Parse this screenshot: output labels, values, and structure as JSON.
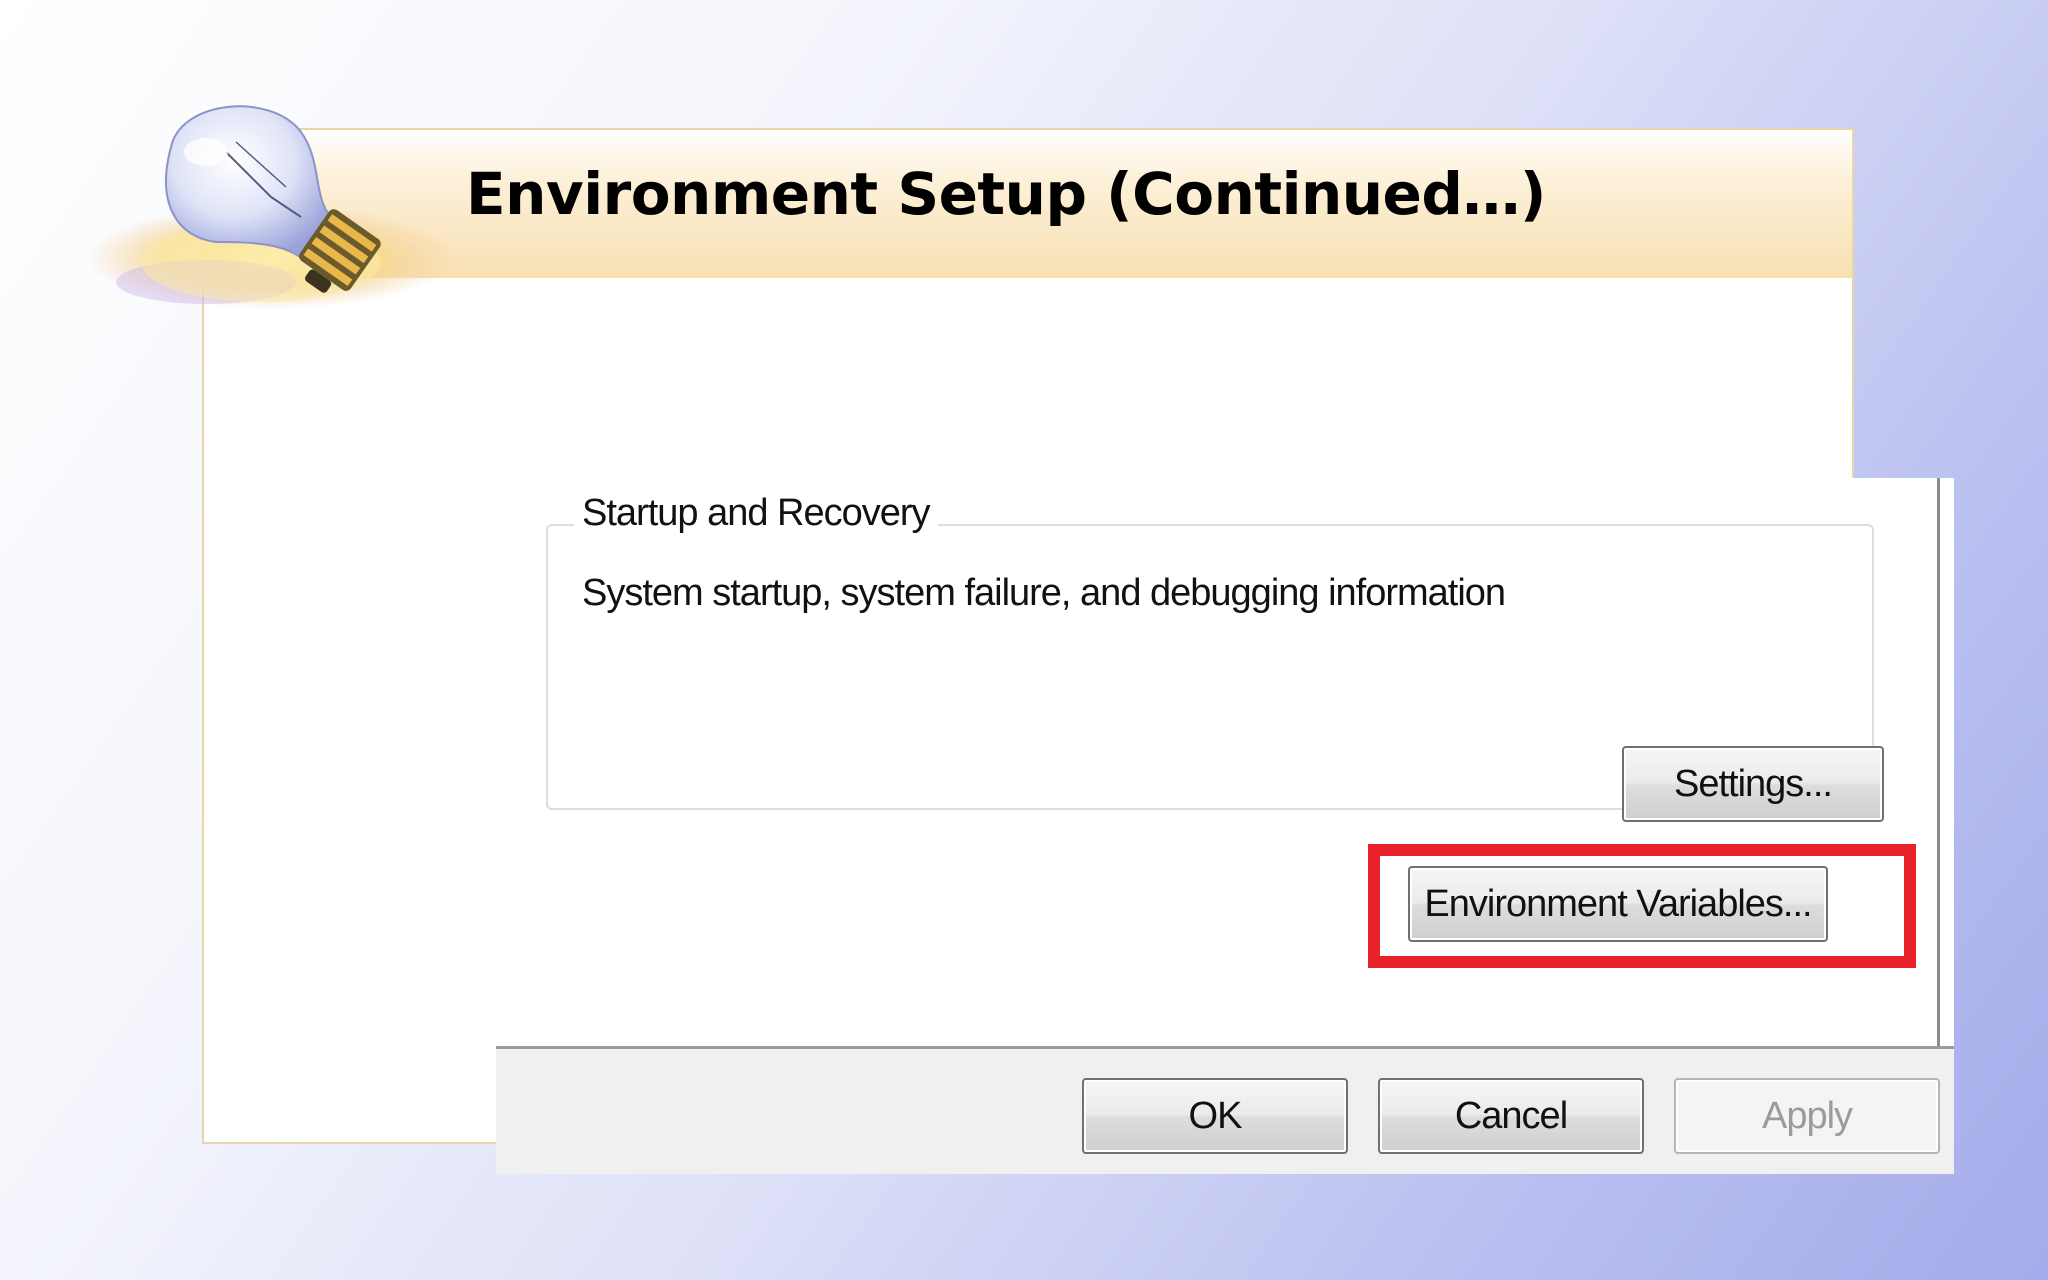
{
  "slide": {
    "title": "Environment Setup (Continued…)",
    "decoration_icon": "lightbulb-icon"
  },
  "dialog": {
    "group": {
      "title": "Startup and Recovery",
      "description": "System startup, system failure, and debugging information",
      "settings_label": "Settings..."
    },
    "environment_variables_label": "Environment Variables...",
    "footer": {
      "ok_label": "OK",
      "cancel_label": "Cancel",
      "apply_label": "Apply"
    }
  },
  "colors": {
    "highlight": "#e8202a",
    "title_band": "#f8e0b1",
    "background_accent": "#a4aceb"
  }
}
